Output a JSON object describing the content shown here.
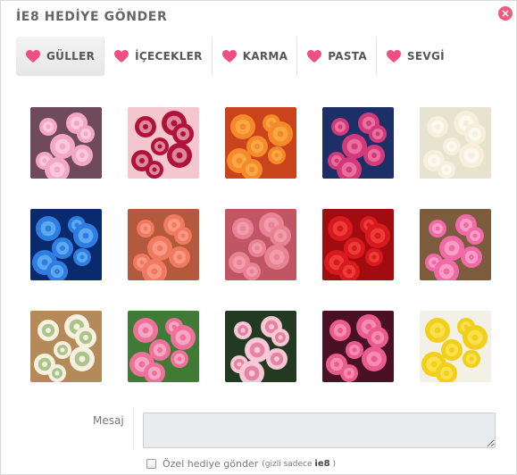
{
  "dialog": {
    "title": "İE8 HEDİYE GÖNDER",
    "close_symbol": "×"
  },
  "tabs": [
    {
      "label": "GÜLLER",
      "icon": "heart-icon",
      "active": true
    },
    {
      "label": "İÇECEKLER",
      "icon": "heart-icon",
      "active": false
    },
    {
      "label": "KARMA",
      "icon": "heart-icon",
      "active": false
    },
    {
      "label": "PASTA",
      "icon": "heart-icon",
      "active": false
    },
    {
      "label": "SEVGİ",
      "icon": "heart-icon",
      "active": false
    }
  ],
  "gifts": [
    {
      "name": "pink-rose-bouquet",
      "bg": "#6e4a5a",
      "petal": "#f3a7c4",
      "accent": "#fde4ee"
    },
    {
      "name": "rose-gift-box",
      "bg": "#f4c7cf",
      "petal": "#b0123a",
      "accent": "#fde9ec"
    },
    {
      "name": "orange-roses",
      "bg": "#c9431d",
      "petal": "#f58a2b",
      "accent": "#f9c05a"
    },
    {
      "name": "pink-roses-vase",
      "bg": "#1c2f66",
      "petal": "#d43a7a",
      "accent": "#f59cc0"
    },
    {
      "name": "cream-roses",
      "bg": "#e7e3cf",
      "petal": "#f7efdc",
      "accent": "#ffffff"
    },
    {
      "name": "blue-rose",
      "bg": "#0a2a6e",
      "petal": "#2f7de0",
      "accent": "#7fd0ff"
    },
    {
      "name": "peach-roses",
      "bg": "#b45a3c",
      "petal": "#f07a60",
      "accent": "#ffb3a0"
    },
    {
      "name": "coral-roses",
      "bg": "#c05664",
      "petal": "#e98292",
      "accent": "#f7b3bd"
    },
    {
      "name": "red-roses",
      "bg": "#a00c10",
      "petal": "#d81a1e",
      "accent": "#ff5a4e"
    },
    {
      "name": "pink-roses-basket",
      "bg": "#7d5b3d",
      "petal": "#ef6aa6",
      "accent": "#ffc7e0"
    },
    {
      "name": "white-roses-bunch",
      "bg": "#b48a58",
      "petal": "#f6f0e0",
      "accent": "#6da047"
    },
    {
      "name": "pink-roses-box",
      "bg": "#3f7b34",
      "petal": "#f0709c",
      "accent": "#f8d6e3"
    },
    {
      "name": "pink-white-roses",
      "bg": "#233a22",
      "petal": "#f6c7d6",
      "accent": "#d64b78"
    },
    {
      "name": "pink-rose-heap",
      "bg": "#4a1024",
      "petal": "#ea5c8d",
      "accent": "#ffb2cc"
    },
    {
      "name": "yellow-roses",
      "bg": "#f3f0e6",
      "petal": "#f2cf1a",
      "accent": "#fff07a"
    }
  ],
  "message": {
    "label": "Mesaj",
    "value": ""
  },
  "private_gift": {
    "label": "Özel hediye gönder",
    "hint_prefix": "(gizli sadece",
    "hint_brand": "ie8",
    "hint_suffix": ")",
    "checked": false
  },
  "colors": {
    "heart": "#ef4f84",
    "close": "#f15a7d"
  }
}
